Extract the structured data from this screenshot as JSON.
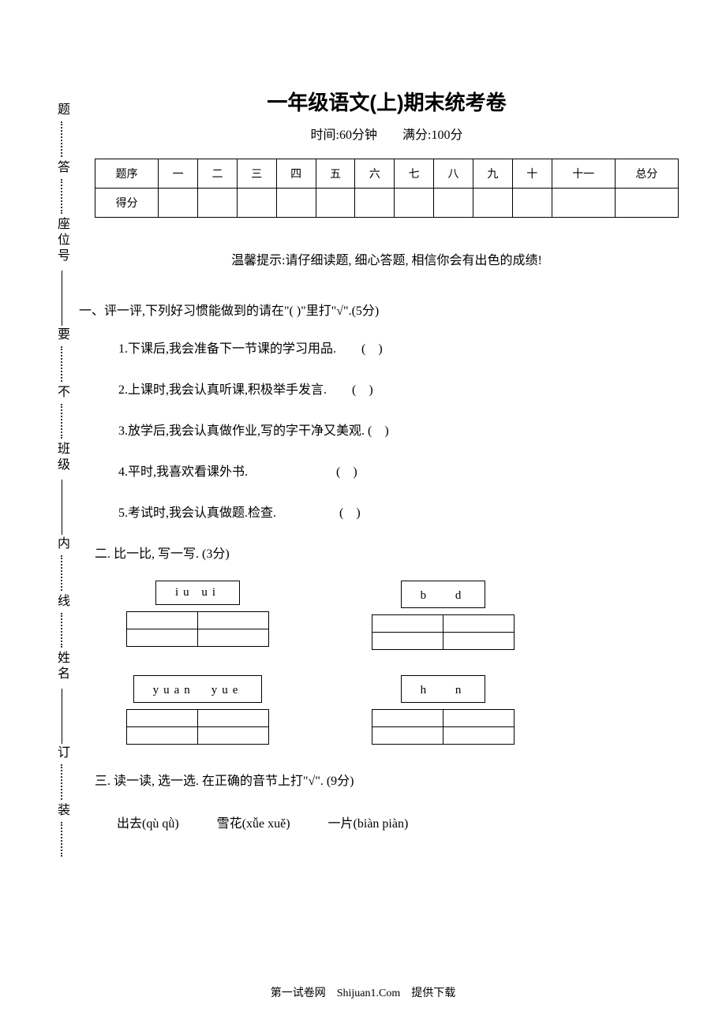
{
  "title": "一年级语文(上)期末统考卷",
  "subtitle": "时间:60分钟　　满分:100分",
  "scoreTable": {
    "headers": [
      "题序",
      "一",
      "二",
      "三",
      "四",
      "五",
      "六",
      "七",
      "八",
      "九",
      "十",
      "十一",
      "总分"
    ],
    "rowLabel": "得分"
  },
  "tip": "温馨提示:请仔细读题, 细心答题, 相信你会有出色的成绩!",
  "section1": {
    "heading": "一、评一评,下列好习惯能做到的请在\"(   )\"里打\"√\".(5分)",
    "items": [
      "1.下课后,我会准备下一节课的学习用品.　　(　)",
      "2.上课时,我会认真听课,积极举手发言.　　(　)",
      "3.放学后,我会认真做作业,写的字干净又美观. (　)",
      "4.平时,我喜欢看课外书.　　　　　　　(　)",
      "5.考试时,我会认真做题.检查.　　　　　(　)"
    ]
  },
  "section2": {
    "heading": "二. 比一比, 写一写. (3分)",
    "pairs": [
      [
        "iu  ui",
        "b　 d"
      ],
      [
        "yuan　yue",
        "h　 n"
      ]
    ]
  },
  "section3": {
    "heading": "三. 读一读, 选一选. 在正确的音节上打\"√\". (9分)",
    "items": [
      "出去(qù  qǜ)",
      "雪花(xǚe  xuě)",
      "一片(biàn  piàn)"
    ]
  },
  "binding": {
    "labels": [
      "题",
      "答",
      "要",
      "不",
      "内",
      "线",
      "订",
      "装"
    ],
    "fields": [
      "座位号",
      "班级",
      "姓名"
    ]
  },
  "footer": {
    "left": "第一试卷网",
    "mid": "Shijuan1.Com",
    "right": "提供下载"
  }
}
